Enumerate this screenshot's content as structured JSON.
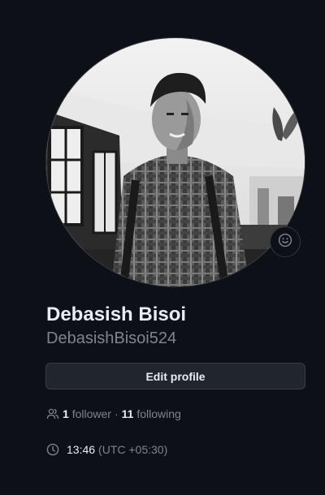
{
  "profile": {
    "display_name": "Debasish Bisoi",
    "username": "DebasishBisoi524",
    "edit_button_label": "Edit profile",
    "avatar_icon": "profile-photo",
    "status_icon": "smiley-icon"
  },
  "followers": {
    "icon": "people-icon",
    "followers_count": "1",
    "followers_label": "follower",
    "separator": "·",
    "following_count": "11",
    "following_label": "following"
  },
  "local_time": {
    "icon": "clock-icon",
    "time": "13:46",
    "timezone": "(UTC +05:30)"
  },
  "colors": {
    "background": "#0d1117",
    "text_primary": "#e6edf3",
    "text_muted": "#7d8590",
    "button_bg": "#21262d",
    "border": "#30363d"
  }
}
